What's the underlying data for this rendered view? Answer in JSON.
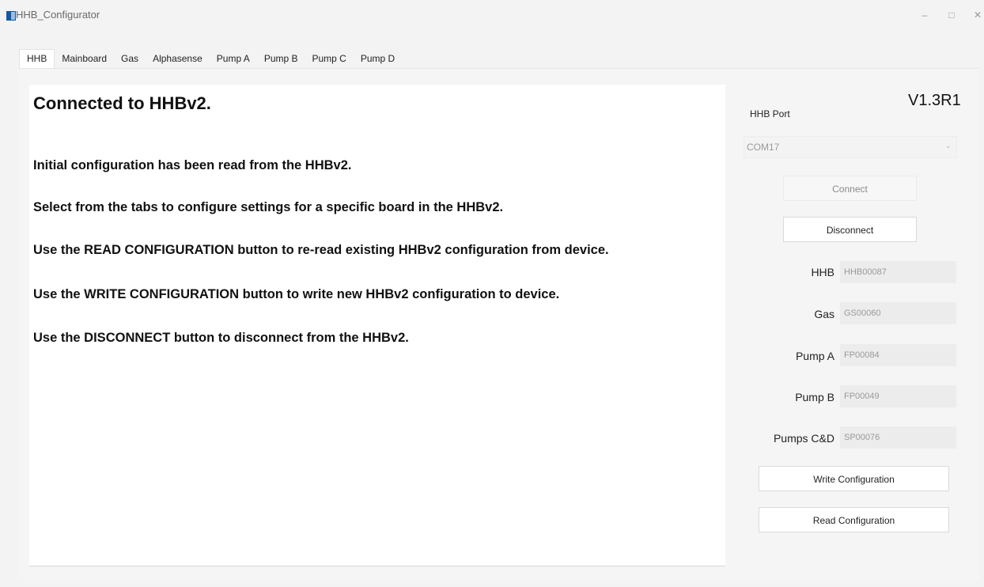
{
  "window": {
    "title": "HHB_Configurator",
    "min_glyph": "–",
    "max_glyph": "□",
    "close_glyph": "✕"
  },
  "tabs": [
    {
      "label": "HHB",
      "active": true
    },
    {
      "label": "Mainboard"
    },
    {
      "label": "Gas"
    },
    {
      "label": "Alphasense"
    },
    {
      "label": "Pump A"
    },
    {
      "label": "Pump B"
    },
    {
      "label": "Pump C"
    },
    {
      "label": "Pump D"
    }
  ],
  "main": {
    "headline": "Connected to HHBv2.",
    "messages": [
      "Initial configuration has been read from the HHBv2.",
      "Select from the tabs to configure settings for a specific board in the HHBv2.",
      "Use the READ CONFIGURATION button to re-read existing HHBv2 configuration from device.",
      "Use the WRITE CONFIGURATION button to write new HHBv2 configuration to device.",
      "Use the DISCONNECT button to disconnect from the HHBv2."
    ]
  },
  "side": {
    "version": "V1.3R1",
    "port_label": "HHB Port",
    "port_value": "COM17",
    "connect_label": "Connect",
    "disconnect_label": "Disconnect",
    "ids": [
      {
        "label": "HHB",
        "value": "HHB00087"
      },
      {
        "label": "Gas",
        "value": "GS00060"
      },
      {
        "label": "Pump A",
        "value": "FP00084"
      },
      {
        "label": "Pump B",
        "value": "FP00049"
      },
      {
        "label": "Pumps C&D",
        "value": "SP00076"
      }
    ],
    "write_label": "Write Configuration",
    "read_label": "Read Configuration"
  },
  "colors": {
    "accent_icon": "#0e5aa7",
    "background": "#f3f3f3",
    "panel": "#ffffff"
  }
}
